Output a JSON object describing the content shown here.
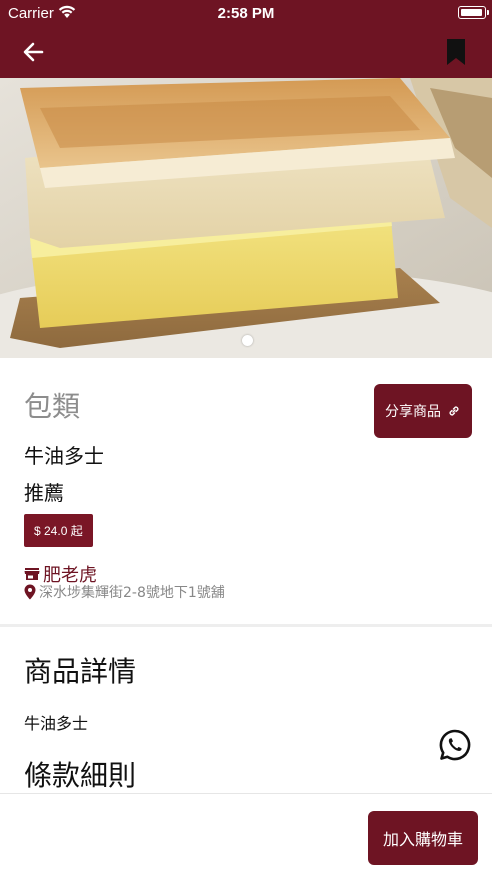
{
  "status_bar": {
    "carrier": "Carrier",
    "time": "2:58 PM"
  },
  "nav": {
    "back_icon": "arrow-left-icon",
    "bookmark_icon": "bookmark-icon"
  },
  "hero": {
    "image_subject": "butter toast",
    "page_indicator": {
      "current": 1,
      "total": 1
    }
  },
  "product": {
    "category": "包類",
    "name": "牛油多士",
    "tag": "推薦",
    "price": "$ 24.0 起",
    "share_label": "分享商品",
    "share_icon": "link-icon"
  },
  "shop": {
    "name": "肥老虎",
    "address": "深水埗集輝街2-8號地下1號舖",
    "shop_icon": "store-icon",
    "location_icon": "map-pin-icon"
  },
  "details": {
    "title": "商品詳情",
    "text": "牛油多士",
    "terms_title": "條款細則"
  },
  "actions": {
    "whatsapp_icon": "whatsapp-icon",
    "add_to_cart_label": "加入購物車"
  },
  "colors": {
    "brand": "#6e1423",
    "muted_text": "#8d8d8d"
  }
}
